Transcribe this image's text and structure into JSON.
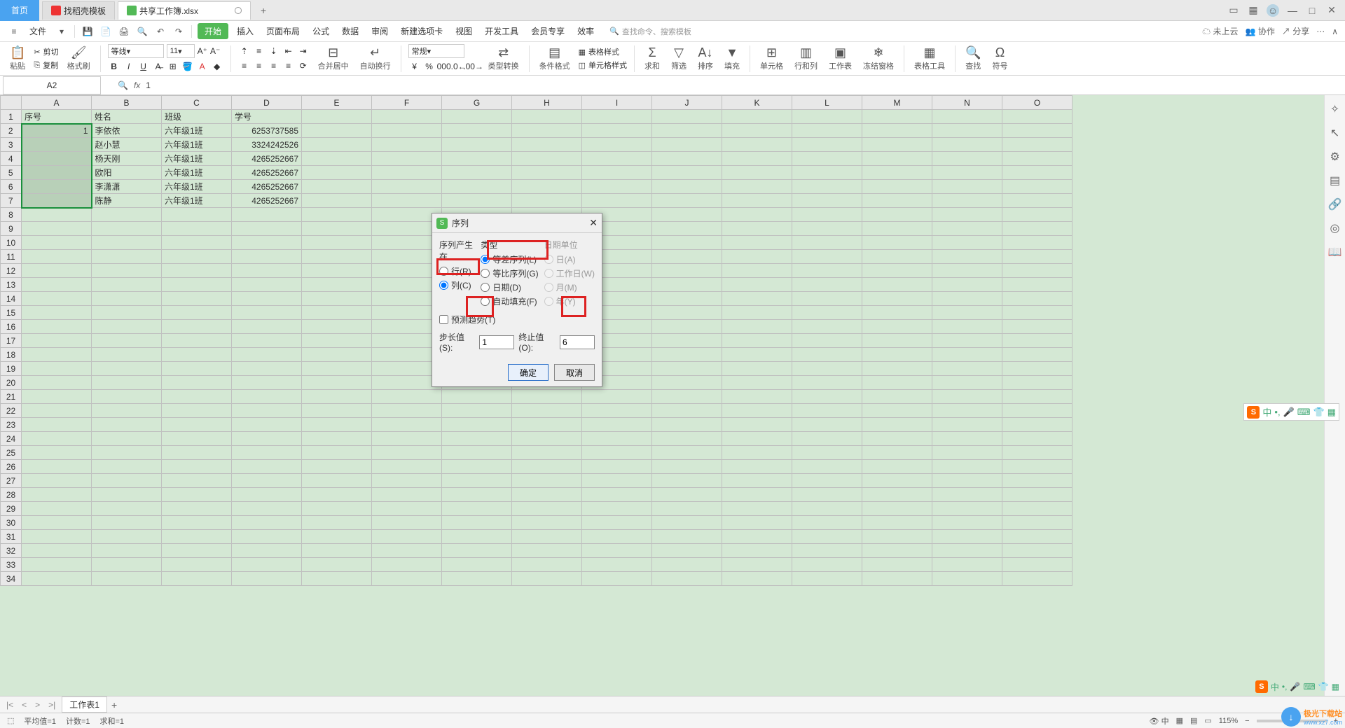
{
  "tabs": {
    "home": "首页",
    "t1": "找稻壳模板",
    "t2": "共享工作簿.xlsx"
  },
  "menu": {
    "file": "文件",
    "items": [
      "开始",
      "插入",
      "页面布局",
      "公式",
      "数据",
      "审阅",
      "新建选项卡",
      "视图",
      "开发工具",
      "会员专享",
      "效率"
    ],
    "search_hint": "查找命令、搜索模板",
    "right": {
      "cloud": "未上云",
      "coop": "协作",
      "share": "分享"
    }
  },
  "ribbon": {
    "paste": "粘贴",
    "cut": "剪切",
    "copy": "复制",
    "fmtpainter": "格式刷",
    "font": "等线",
    "size": "11",
    "merge": "合并居中",
    "wrap": "自动换行",
    "numfmt": "常规",
    "typeconv": "类型转换",
    "condfmt": "条件格式",
    "tablefmt": "表格样式",
    "cellfmt": "单元格样式",
    "sum": "求和",
    "filter": "筛选",
    "sort": "排序",
    "fill": "填充",
    "cells": "单元格",
    "rowcol": "行和列",
    "worksheet": "工作表",
    "freeze": "冻结窗格",
    "tabletool": "表格工具",
    "find": "查找",
    "symbol": "符号"
  },
  "fbar": {
    "name": "A2",
    "fx": "fx",
    "formula": "1"
  },
  "grid": {
    "cols": [
      "A",
      "B",
      "C",
      "D",
      "E",
      "F",
      "G",
      "H",
      "I",
      "J",
      "K",
      "L",
      "M",
      "N",
      "O"
    ],
    "headers": {
      "A": "序号",
      "B": "姓名",
      "C": "班级",
      "D": "学号"
    },
    "rows": [
      {
        "A": "1",
        "B": "李依依",
        "C": "六年级1班",
        "D": "6253737585"
      },
      {
        "A": "",
        "B": "赵小慧",
        "C": "六年级1班",
        "D": "3324242526"
      },
      {
        "A": "",
        "B": "杨天刚",
        "C": "六年级1班",
        "D": "4265252667"
      },
      {
        "A": "",
        "B": "欧阳",
        "C": "六年级1班",
        "D": "4265252667"
      },
      {
        "A": "",
        "B": "李潇潇",
        "C": "六年级1班",
        "D": "4265252667"
      },
      {
        "A": "",
        "B": "陈静",
        "C": "六年级1班",
        "D": "4265252667"
      }
    ]
  },
  "dialog": {
    "title": "序列",
    "group_in": "序列产生在",
    "opt_row": "行(R)",
    "opt_col": "列(C)",
    "group_type": "类型",
    "opt_arith": "等差序列(L)",
    "opt_geo": "等比序列(G)",
    "opt_date": "日期(D)",
    "opt_auto": "自动填充(F)",
    "group_dateunit": "日期单位",
    "opt_day": "日(A)",
    "opt_workday": "工作日(W)",
    "opt_month": "月(M)",
    "opt_year": "年(Y)",
    "predict": "预测趋势(T)",
    "step_label": "步长值(S):",
    "step_val": "1",
    "stop_label": "终止值(O):",
    "stop_val": "6",
    "ok": "确定",
    "cancel": "取消"
  },
  "sheet": {
    "sheet1": "工作表1"
  },
  "status": {
    "avg": "平均值=1",
    "count": "计数=1",
    "sum": "求和=1",
    "zoom": "115%"
  },
  "watermark": {
    "t1": "极光下载站",
    "t2": "www.xz7.com"
  }
}
